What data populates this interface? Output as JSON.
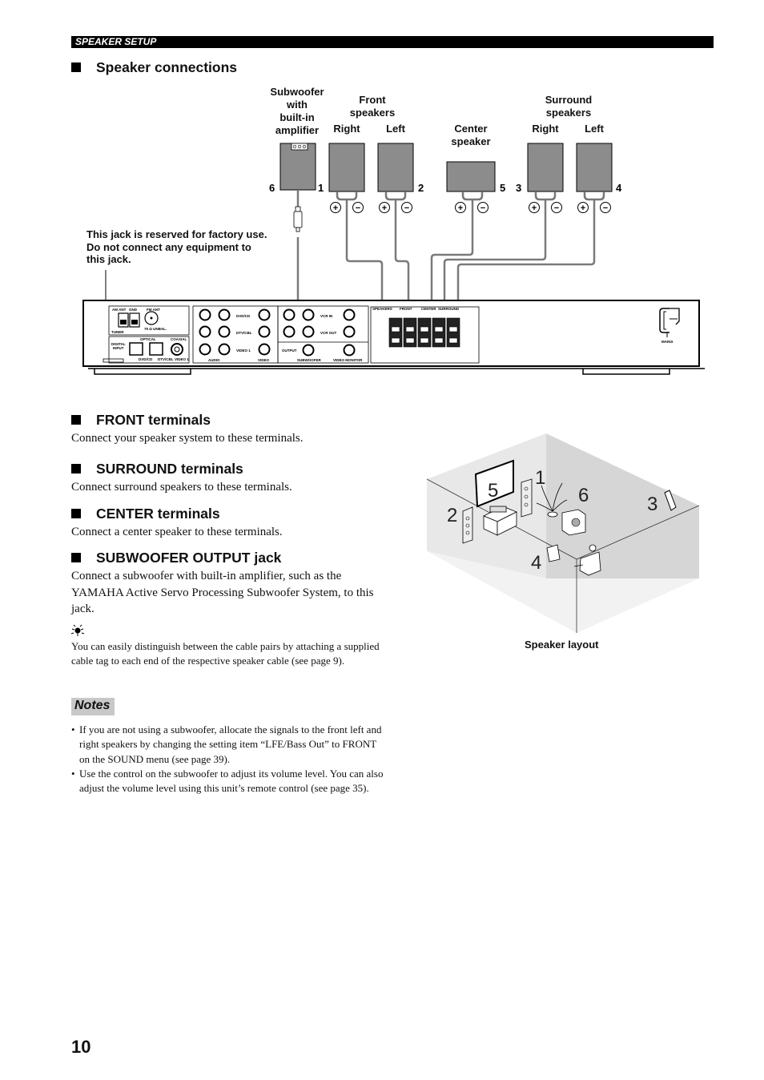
{
  "header": {
    "section_label": "SPEAKER SETUP"
  },
  "speaker_connections": {
    "title": "Speaker connections",
    "labels": {
      "subwoofer": [
        "Subwoofer",
        "with",
        "built-in",
        "amplifier"
      ],
      "front_speakers": [
        "Front",
        "speakers"
      ],
      "front_right": "Right",
      "front_left": "Left",
      "center_speaker": [
        "Center",
        "speaker"
      ],
      "surround_speakers": [
        "Surround",
        "speakers"
      ],
      "surround_right": "Right",
      "surround_left": "Left"
    },
    "numbers": {
      "subwoofer": "6",
      "front_right": "1",
      "front_left": "2",
      "center": "5",
      "surround_right": "3",
      "surround_left": "4"
    },
    "polarity": {
      "plus": "+",
      "minus": "−"
    },
    "factory_note": [
      "This jack is reserved for factory use.",
      "Do not connect any equipment to",
      "this jack."
    ],
    "rear_panel": {
      "am_ant": "AM ANT",
      "gnd": "GND",
      "fm_ant": "FM ANT",
      "tuner": "TUNER",
      "fm_ohm": "75 Ω UNBAL.",
      "digital_input": [
        "DIGITAL",
        "INPUT"
      ],
      "optical": "OPTICAL",
      "coaxial": "COAXIAL",
      "opt1": "DVD/CD",
      "opt2": "DTV/CBL",
      "coax3": "VIDEO 1",
      "dvd_cd": "DVD/CD",
      "dtv_cbl": "DTV/CBL",
      "video1": "VIDEO 1",
      "audio": "AUDIO",
      "video": "VIDEO",
      "vcr_in": "VCR IN",
      "vcr_out": "VCR OUT",
      "output": "OUTPUT",
      "subwoofer": "SUBWOOFER",
      "video_monitor": "VIDEO MONITOR",
      "speakers": "SPEAKERS",
      "front": "FRONT",
      "center": "CENTER",
      "surround": "SURROUND",
      "mains": "MAINS"
    }
  },
  "sections": [
    {
      "title": "FRONT terminals",
      "body": "Connect your speaker system to these terminals."
    },
    {
      "title": "SURROUND terminals",
      "body": "Connect surround speakers to these terminals."
    },
    {
      "title": "CENTER terminals",
      "body": "Connect a center speaker to these terminals."
    },
    {
      "title": "SUBWOOFER OUTPUT jack",
      "body": "Connect a subwoofer with built-in amplifier, such as the YAMAHA Active Servo Processing Subwoofer System, to this jack."
    }
  ],
  "tip": {
    "icon": "lightbulb-tip-icon",
    "text": "You can easily distinguish between the cable pairs by attaching a supplied cable tag to each end of the respective speaker cable (see page 9)."
  },
  "notes": {
    "label": "Notes",
    "items": [
      "If you are not using a subwoofer, allocate the signals to the front left and right speakers by changing the setting item “LFE/Bass Out” to FRONT on the SOUND menu (see page 39).",
      "Use the control on the subwoofer to adjust its volume level. You can also adjust the volume level using this unit’s remote control (see page 35)."
    ]
  },
  "speaker_layout": {
    "caption": "Speaker layout",
    "positions": {
      "front_right": "1",
      "front_left": "2",
      "surround_right": "3",
      "surround_left": "4",
      "center": "5",
      "subwoofer": "6"
    }
  },
  "page_number": "10"
}
